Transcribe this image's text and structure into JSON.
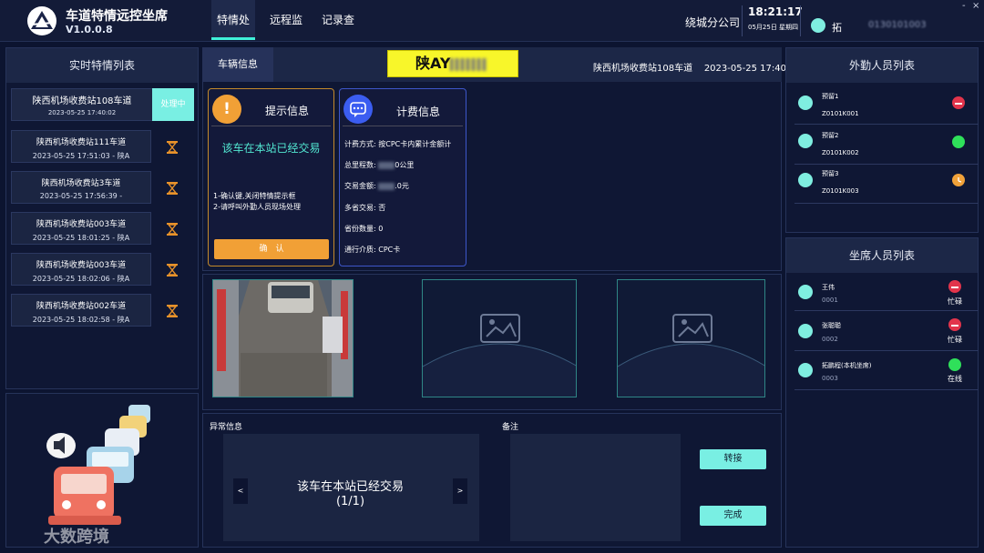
{
  "app": {
    "title": "车道特情远控坐席",
    "version": "V1.0.0.8"
  },
  "nav": {
    "tabs": [
      "特情处理",
      "远程监控",
      "记录查询"
    ]
  },
  "header": {
    "branch": "绕城分公司",
    "time": "18:21:17",
    "date": "05月25日 星期四",
    "user_name": "拓",
    "user_id": "0130101003",
    "close_glyph": "-",
    "min_glyph": "×"
  },
  "realtime": {
    "title": "实时特情列表",
    "items": [
      {
        "title": "陕西机场收费站108车道",
        "time": "2023-05-25 17:40:02",
        "status": "处理中"
      },
      {
        "title": "陕西机场收费站111车道",
        "time": "2023-05-25 17:51:03 - 陕A"
      },
      {
        "title": "陕西机场收费站3车道",
        "time": "2023-05-25 17:56:39 -"
      },
      {
        "title": "陕西机场收费站003车道",
        "time": "2023-05-25 18:01:25 - 陕A"
      },
      {
        "title": "陕西机场收费站003车道",
        "time": "2023-05-25 18:02:06 - 陕A"
      },
      {
        "title": "陕西机场收费站002车道",
        "time": "2023-05-25 18:02:58 - 陕A"
      }
    ]
  },
  "vehicle": {
    "tab": "车辆信息",
    "plate": "陕AY",
    "lane": "陕西机场收费站108车道",
    "time": "2023-05-25 17:40:02"
  },
  "tip": {
    "title": "提示信息",
    "message": "该车在本站已经交易",
    "steps": [
      "1-确认键,关闭特情提示框",
      "2-请呼叫外勤人员现场处理"
    ],
    "confirm": "确　认"
  },
  "fee": {
    "title": "计费信息",
    "lines": [
      {
        "label": "计费方式: ",
        "value": "按CPC卡内累计金额计"
      },
      {
        "label": "总里程数: ",
        "value": "0公里"
      },
      {
        "label": "交易金额: ",
        "value": ".0元"
      },
      {
        "label": "多省交易: ",
        "value": "否"
      },
      {
        "label": "省份数量: ",
        "value": "0"
      },
      {
        "label": "通行介质: ",
        "value": "CPC卡"
      }
    ]
  },
  "field_staff": {
    "title": "外勤人员列表",
    "items": [
      {
        "name": "预留1",
        "code": "Z0101K001",
        "status_color": "#e2344b"
      },
      {
        "name": "预留2",
        "code": "Z0101K002",
        "status_color": "#2fe05a"
      },
      {
        "name": "预留3",
        "code": "Z0101K003",
        "status_color": "#f0a23a"
      }
    ]
  },
  "seat_staff": {
    "title": "坐席人员列表",
    "items": [
      {
        "name": "王伟",
        "code": "0001",
        "status": "忙碌",
        "status_color": "#e2344b"
      },
      {
        "name": "张聪聪",
        "code": "0002",
        "status": "忙碌",
        "status_color": "#e2344b"
      },
      {
        "name": "拓鹏程(本机坐席)",
        "code": "0003",
        "status": "在线",
        "status_color": "#2fe05a"
      }
    ]
  },
  "abnormal": {
    "label": "异常信息",
    "message": "该车在本站已经交易",
    "page": "(1/1)",
    "prev": "<",
    "next": ">"
  },
  "remark": {
    "label": "备注"
  },
  "actions": {
    "transfer": "转接",
    "done": "完成"
  },
  "watermark": "大数跨境",
  "colors": {
    "accent": "#3ff0d8",
    "busy": "#e2344b",
    "online": "#2fe05a",
    "pending": "#f0a23a"
  }
}
